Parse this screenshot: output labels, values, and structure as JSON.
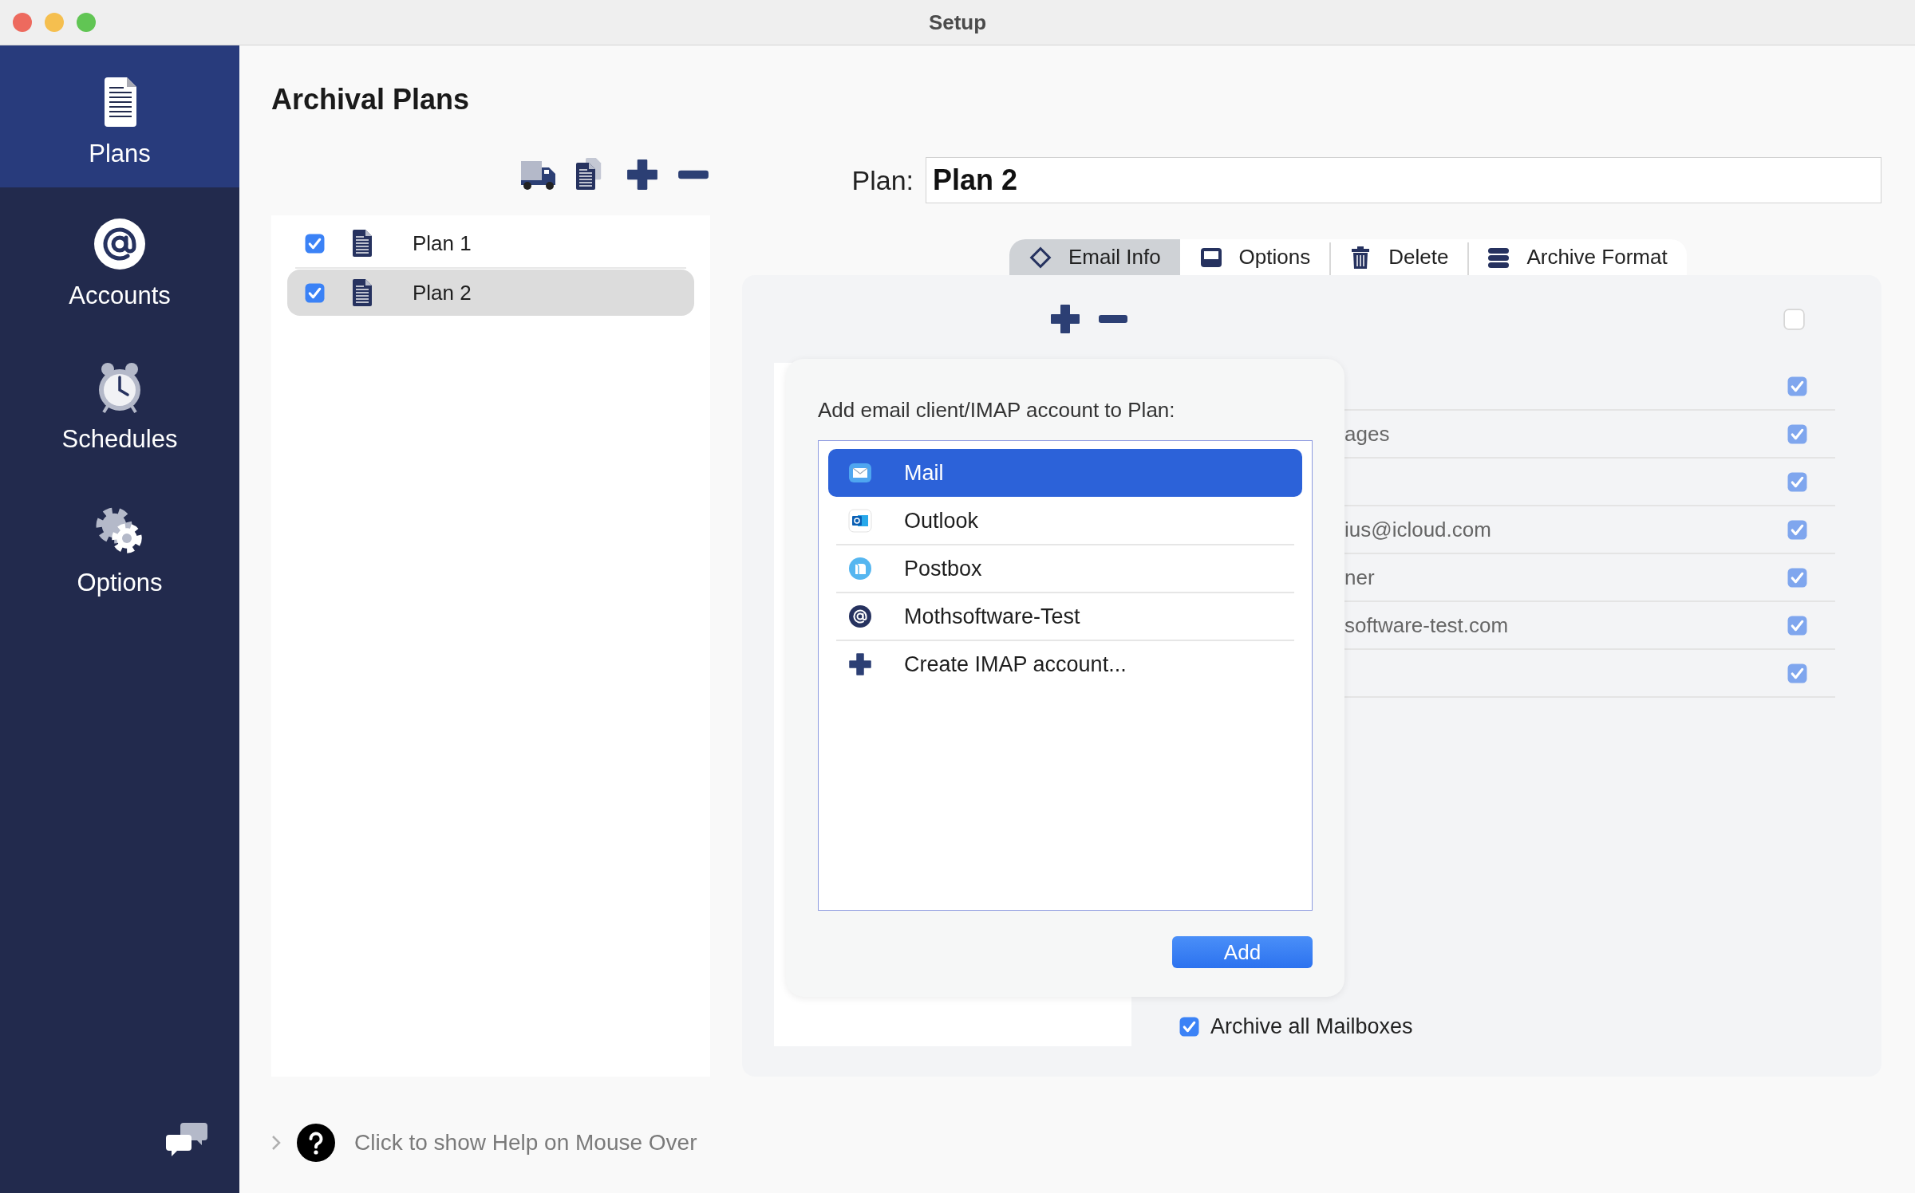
{
  "window": {
    "title": "Setup"
  },
  "sidebar": {
    "items": [
      {
        "label": "Plans",
        "kind": "plans",
        "selected": true
      },
      {
        "label": "Accounts",
        "kind": "accounts",
        "selected": false
      },
      {
        "label": "Schedules",
        "kind": "schedules",
        "selected": false
      },
      {
        "label": "Options",
        "kind": "options",
        "selected": false
      }
    ]
  },
  "page_title": "Archival Plans",
  "plans": [
    {
      "name": "Plan 1",
      "checked": true,
      "selected": false
    },
    {
      "name": "Plan 2",
      "checked": true,
      "selected": true
    }
  ],
  "plan_name": {
    "label": "Plan:",
    "value": "Plan 2"
  },
  "tabs": [
    {
      "label": "Email Info",
      "kind": "info",
      "selected": true
    },
    {
      "label": "Options",
      "kind": "options",
      "selected": false
    },
    {
      "label": "Delete",
      "kind": "delete",
      "selected": false
    },
    {
      "label": "Archive Format",
      "kind": "format",
      "selected": false
    }
  ],
  "accounts_header": {
    "checked": false
  },
  "account_rows": [
    {
      "checked": true
    },
    {
      "text": "ages",
      "checked": true
    },
    {
      "checked": true
    },
    {
      "text": "ius@icloud.com",
      "checked": true
    },
    {
      "text": "ner",
      "checked": true
    },
    {
      "text": "software-test.com",
      "checked": true
    },
    {
      "checked": true
    }
  ],
  "popover": {
    "prompt": "Add email client/IMAP account to Plan:",
    "clients": [
      {
        "label": "Mail",
        "kind": "mail",
        "selected": true
      },
      {
        "label": "Outlook",
        "kind": "outlook",
        "selected": false
      },
      {
        "label": "Postbox",
        "kind": "postbox",
        "selected": false
      },
      {
        "label": "Mothsoftware-Test",
        "kind": "imap",
        "selected": false
      },
      {
        "label": "Create IMAP account...",
        "kind": "create",
        "selected": false
      }
    ],
    "button": "Add"
  },
  "archive_all": {
    "label": "Archive all Mailboxes",
    "checked": true
  },
  "help": {
    "text": "Click to show Help on Mouse Over"
  }
}
